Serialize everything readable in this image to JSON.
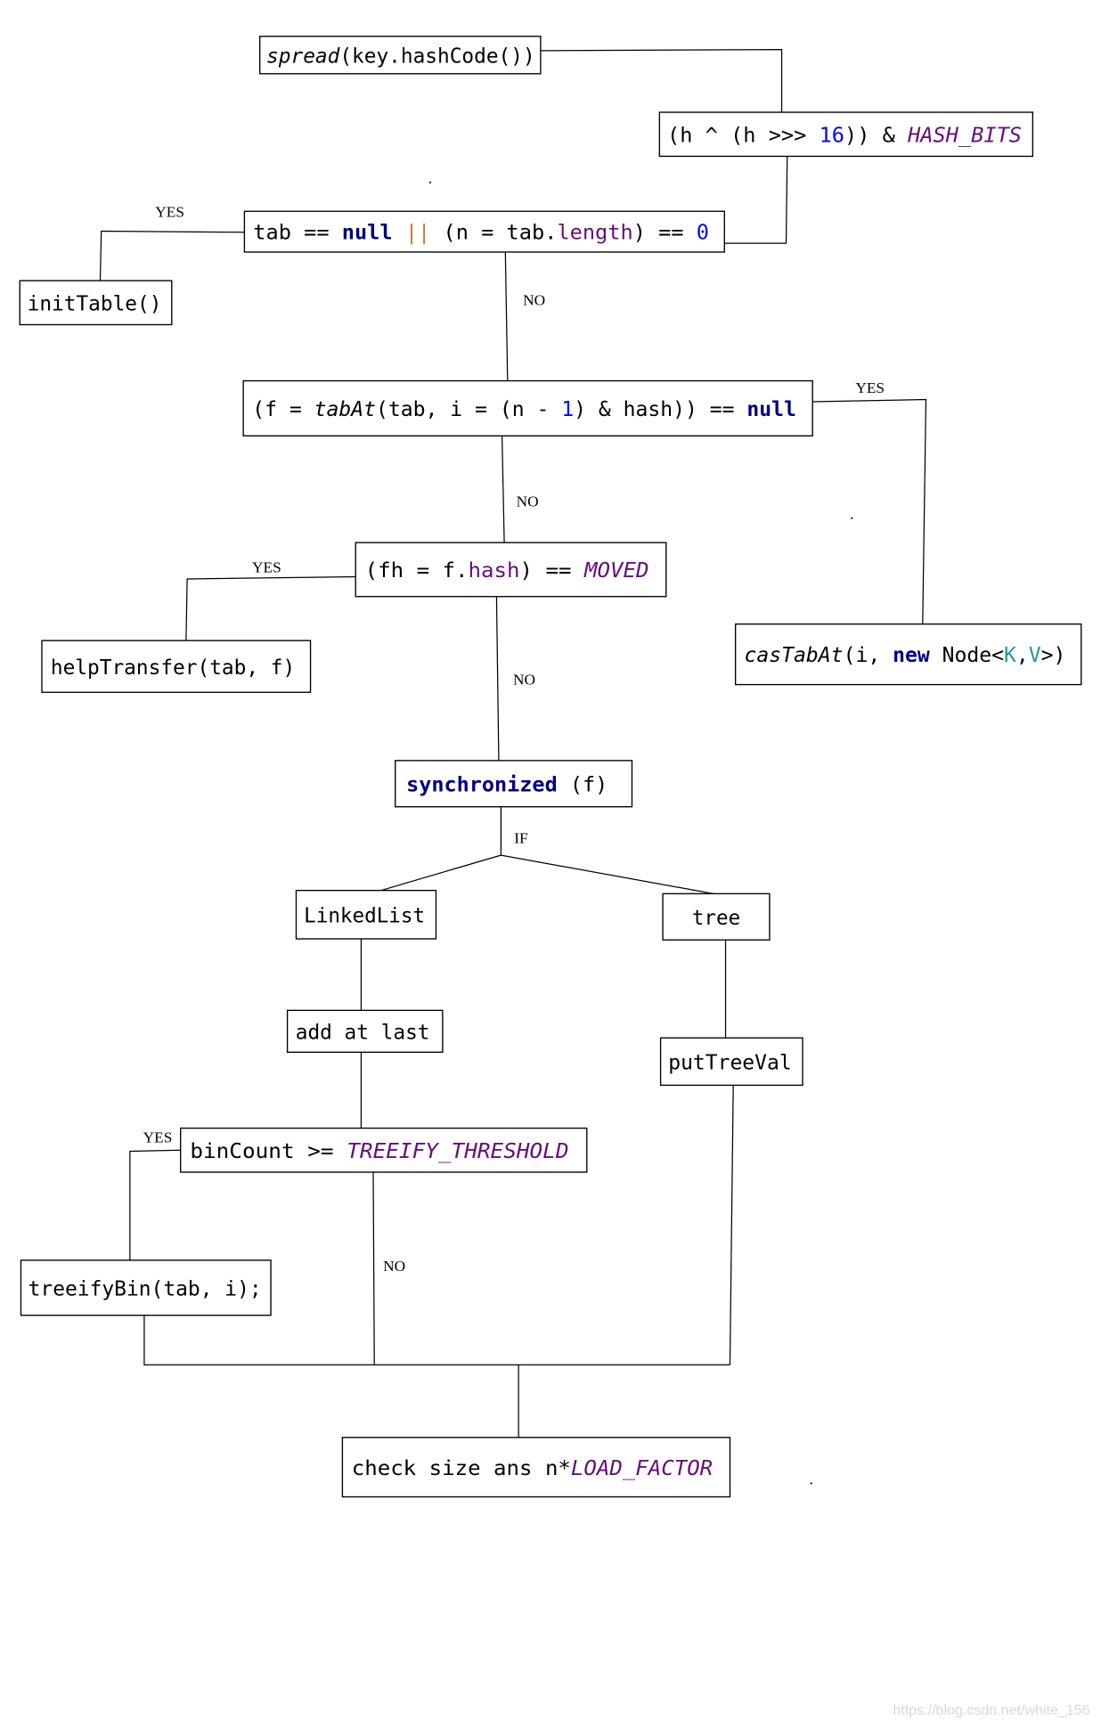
{
  "colors": {
    "default": "#000000",
    "keyword": "#000080",
    "number": "#0000ff",
    "field": "#660e7a",
    "operator": "#cc7832",
    "generic": "#20999d"
  },
  "boxes": [
    {
      "id": "spread",
      "segments": [
        {
          "t": "spread",
          "i": true
        },
        {
          "t": "(key.hashCode())"
        }
      ]
    },
    {
      "id": "hash-bits",
      "segments": [
        {
          "t": "(h ^ (h >>> "
        },
        {
          "t": "16",
          "c": "number"
        },
        {
          "t": ")) & "
        },
        {
          "t": "HASH_BITS",
          "c": "field",
          "i": true
        }
      ]
    },
    {
      "id": "table-null-check",
      "segments": [
        {
          "t": "tab == "
        },
        {
          "t": "null",
          "c": "keyword",
          "b": true
        },
        {
          "t": " || ",
          "c": "operator"
        },
        {
          "t": "(n = tab."
        },
        {
          "t": "length",
          "c": "field"
        },
        {
          "t": ") == "
        },
        {
          "t": "0",
          "c": "number"
        }
      ]
    },
    {
      "id": "init-table",
      "segments": [
        {
          "t": "initTable()"
        }
      ]
    },
    {
      "id": "tab-at-null-check",
      "segments": [
        {
          "t": "(f = "
        },
        {
          "t": "tabAt",
          "i": true
        },
        {
          "t": "(tab, i = (n - "
        },
        {
          "t": "1",
          "c": "number"
        },
        {
          "t": ") & hash)) == "
        },
        {
          "t": "null",
          "c": "keyword",
          "b": true
        }
      ]
    },
    {
      "id": "moved-check",
      "segments": [
        {
          "t": "(fh = f."
        },
        {
          "t": "hash",
          "c": "field"
        },
        {
          "t": ") == "
        },
        {
          "t": "MOVED",
          "c": "field",
          "i": true
        }
      ]
    },
    {
      "id": "help-transfer",
      "segments": [
        {
          "t": "helpTransfer(tab, f)"
        }
      ]
    },
    {
      "id": "cas-tab-at",
      "segments": [
        {
          "t": "casTabAt",
          "i": true
        },
        {
          "t": "(i, "
        },
        {
          "t": "new",
          "c": "keyword",
          "b": true
        },
        {
          "t": " Node<"
        },
        {
          "t": "K",
          "c": "generic"
        },
        {
          "t": ","
        },
        {
          "t": "V",
          "c": "generic"
        },
        {
          "t": ">)"
        }
      ]
    },
    {
      "id": "synchronized",
      "segments": [
        {
          "t": "synchronized",
          "c": "keyword",
          "b": true
        },
        {
          "t": " (f)"
        }
      ]
    },
    {
      "id": "linked-list",
      "segments": [
        {
          "t": "LinkedList"
        }
      ]
    },
    {
      "id": "tree",
      "segments": [
        {
          "t": "tree"
        }
      ]
    },
    {
      "id": "add-at-last",
      "segments": [
        {
          "t": "add at last"
        }
      ]
    },
    {
      "id": "put-tree-val",
      "segments": [
        {
          "t": "putTreeVal"
        }
      ]
    },
    {
      "id": "bin-count-check",
      "segments": [
        {
          "t": "binCount >= "
        },
        {
          "t": "TREEIFY_THRESHOLD",
          "c": "field",
          "i": true
        }
      ]
    },
    {
      "id": "treeify-bin",
      "segments": [
        {
          "t": "treeifyBin(tab, i);"
        }
      ]
    },
    {
      "id": "check-size",
      "segments": [
        {
          "t": "check size ans n*"
        },
        {
          "t": "LOAD_FACTOR",
          "c": "field",
          "i": true
        }
      ]
    }
  ],
  "labels": [
    "YES",
    "NO",
    "YES",
    "NO",
    "YES",
    "NO",
    "IF",
    "YES",
    "NO"
  ],
  "watermark": "https://blog.csdn.net/white_156"
}
